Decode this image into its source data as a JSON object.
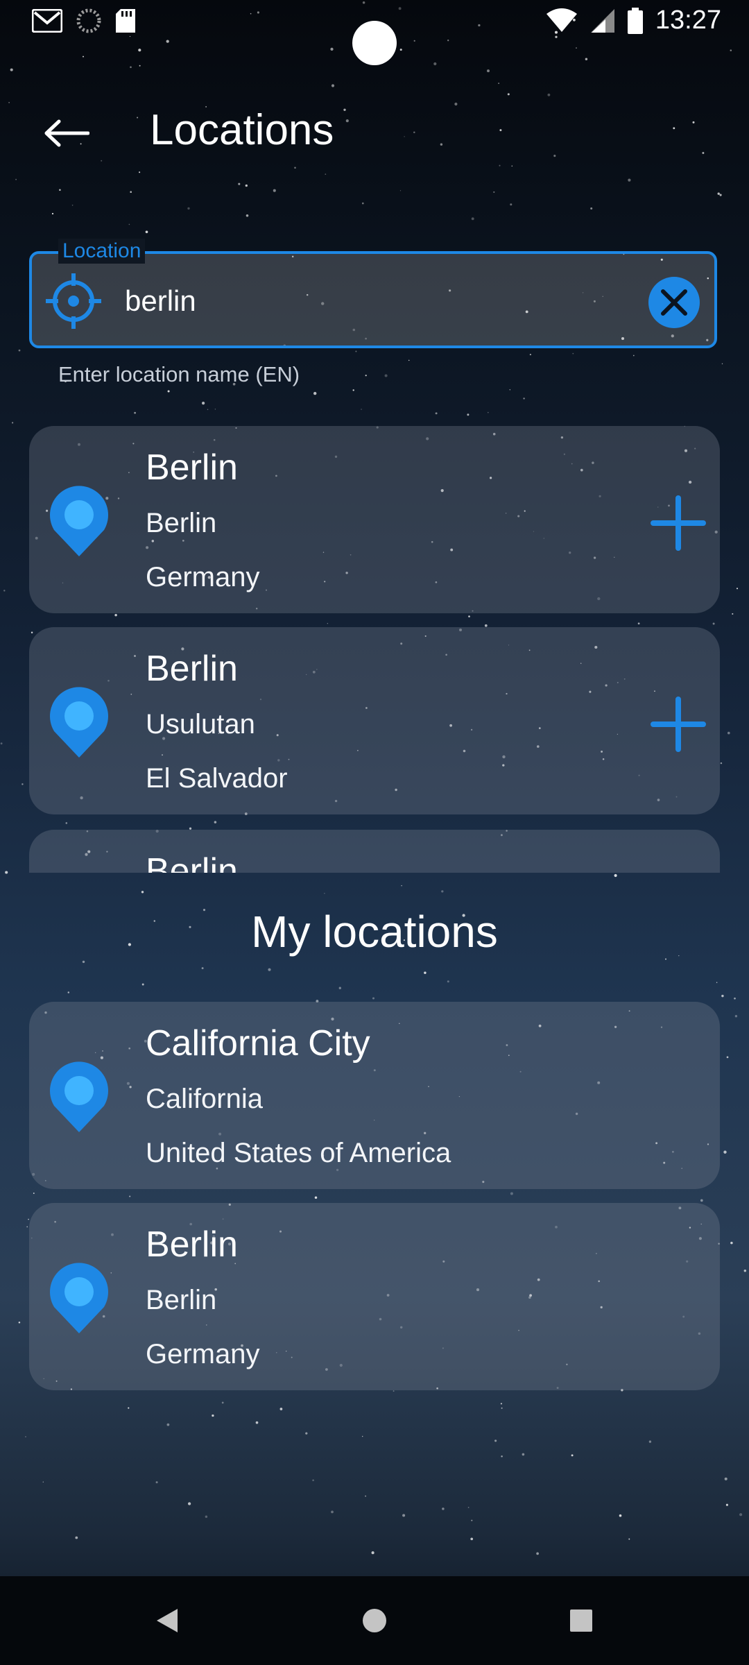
{
  "status_bar": {
    "time": "13:27",
    "left_icons": [
      "gmail-icon",
      "loading-icon",
      "sd-card-icon"
    ],
    "right_icons": [
      "wifi-icon",
      "cell-signal-icon",
      "battery-icon"
    ]
  },
  "app_bar": {
    "title": "Locations",
    "back_icon": "arrow-left-icon"
  },
  "search": {
    "label": "Location",
    "value": "berlin",
    "helper": "Enter location name (EN)",
    "leading_icon": "crosshair-icon",
    "trailing_icon": "clear-circle-icon"
  },
  "results": [
    {
      "name": "Berlin",
      "region": "Berlin",
      "country": "Germany"
    },
    {
      "name": "Berlin",
      "region": "Usulutan",
      "country": "El Salvador"
    },
    {
      "name": "Berlin",
      "region": "",
      "country": ""
    }
  ],
  "my_locations": {
    "title": "My locations",
    "items": [
      {
        "name": "California City",
        "region": "California",
        "country": "United States of America"
      },
      {
        "name": "Berlin",
        "region": "Berlin",
        "country": "Germany"
      }
    ]
  },
  "colors": {
    "accent": "#1e88e5",
    "pin_inner": "#40b4ff"
  },
  "nav_bar": {
    "icons": [
      "back-triangle-icon",
      "home-circle-icon",
      "recents-square-icon"
    ]
  }
}
